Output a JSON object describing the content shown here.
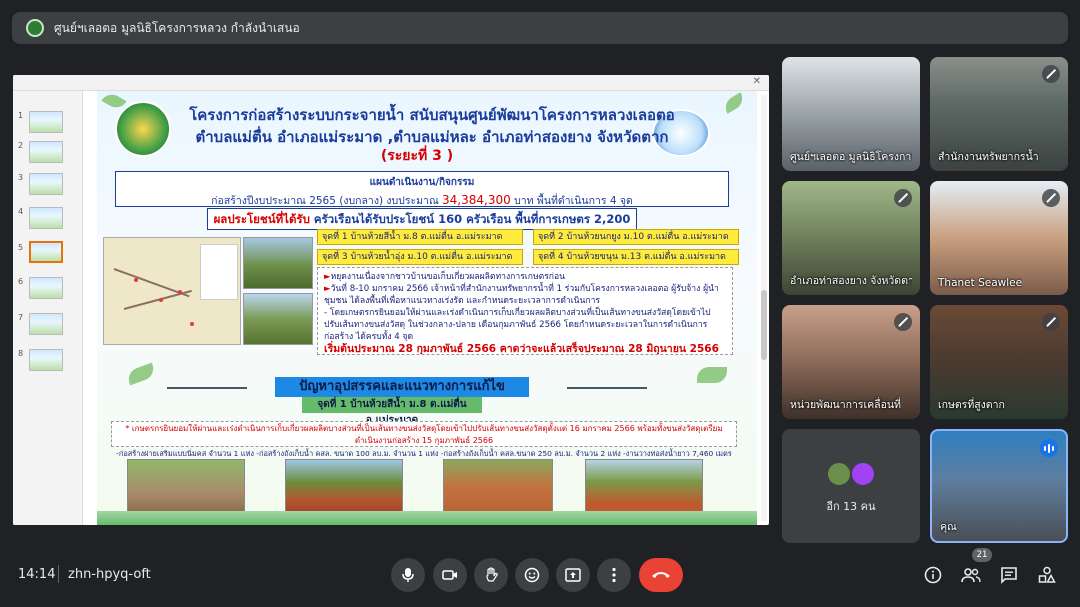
{
  "presenter": {
    "title": "ศูนย์ฯเลอตอ มูลนิธิโครงการหลวง กำลังนำเสนอ"
  },
  "slide": {
    "title_line1": "โครงการก่อสร้างระบบกระจายน้ำ สนับสนุนศูนย์พัฒนาโครงการหลวงเลอตอ",
    "title_line2": "ตำบลแม่ตื่น อำเภอแม่ระมาด ,ตำบลแม่หละ อำเภอท่าสองยาง จังหวัดตาก",
    "phase": "(ระยะที่ 3 )",
    "plan_heading": "แผนดำเนินงาน/กิจกรรม",
    "plan_text_pre": "ก่อสร้างปีงบประมาณ 2565 (งบกลาง) งบประมาณ",
    "plan_amount": "34,384,300",
    "plan_text_post": "บาท พื้นที่ดำเนินการ 4 จุด",
    "benefit_label": "ผลประโยชน์ที่ได้รับ",
    "benefit_text": "ครัวเรือนได้รับประโยชน์ 160 ครัวเรือน  พื้นที่การเกษตร 2,200",
    "sites": [
      "จุดที่ 1 บ้านห้วยสีน้ำ ม.8 ต.แม่ตื่น อ.แม่ระมาด",
      "จุดที่ 2 บ้านห้วยนกยูง ม.10 ต.แม่ตื่น อ.แม่ระมาด",
      "จุดที่ 3 บ้านห้วยน้ำอุ่ง ม.10 ต.แม่ตื่น อ.แม่ระมาด",
      "จุดที่ 4 บ้านห้วยขนุน ม.13 ต.แม่ตื่น อ.แม่ระมาด"
    ],
    "notes": {
      "n1": "หยุดงานเนื่องจากชาวบ้านขอเก็บเกี่ยวผลผลิตทางการเกษตรก่อน",
      "n2": "วันที่ 8-10 มกราคม 2566 เจ้าหน้าที่สำนักงานทรัพยากรน้ำที่ 1 ร่วมกับโครงการหลวงเลอตอ ผู้รับจ้าง ผู้นำชุมชน ได้ลงพื้นที่เพื่อหาแนวทางเร่งรัด และกำหนดระยะเวลาการดำเนินการ",
      "n3": "- โดยเกษตรกรยินยอมให้ผ่านและเร่งดำเนินการเก็บเกี่ยวผลผลิตบางส่วนที่เป็นเส้นทางขนส่งวัสดุโดยเข้าไปปรับเส้นทางขนส่งวัสดุ ในช่วงกลาง-ปลาย เดือนกุมภาพันธ์ 2566   โดยกำหนดระยะเวลาในการดำเนินการก่อสร้าง ได้ครบทั้ง 4  จุด",
      "n4": "เริ่มต้นประมาณ 28  กุมภาพันธ์ 2566  คาดว่าจะแล้วเสร็จประมาณ 28 มิถุนายน 2566"
    },
    "problem_title": "ปัญหาอุปสรรคและแนวทางการแก้ไข",
    "problem_sub": "จุดที่ 1 บ้านห้วยสีน้ำ ม.8 ต.แม่ตื่น อ.แม่ระมาด",
    "warning": "* เกษตรกรยินยอมให้ผ่านและเร่งดำเนินการเก็บเกี่ยวผลผลิตบางส่วนที่เป็นเส้นทางขนส่งวัสดุโดยเข้าไปปรับเส้นทางขนส่งวัสดุตั้งแต่ 16 มกราคม 2566 พร้อมทั้งขนส่งวัสดุเตรียมดำเนินงานก่อสร้าง 15 กุมภาพันธ์ 2566",
    "description": "-ก่อสร้างฝายเสริมแบบนิ่มคส จำนวน 1 แห่ง  -ก่อสร้างถังเก็บน้ำ คสล. ขนาด 100 ลบ.ม. จำนวน 1 แห่ง  -ก่อสร้างถังเก็บน้ำ คสล.ขนาด 250 ลบ.ม. จำนวน 2 แห่ง  -งานวางท่อส่งน้ำยาว 7,460 เมตร"
  },
  "thumbnails": [
    "1",
    "2",
    "3",
    "4",
    "5",
    "6",
    "7",
    "8"
  ],
  "participants": [
    {
      "name": "ศูนย์ฯเลอตอ มูลนิธิโครงการหลวง",
      "muted": false
    },
    {
      "name": "สำนักงานทรัพยากรน้ำ",
      "muted": true
    },
    {
      "name": "อำเภอท่าสองยาง จังหวัดตาก",
      "muted": true
    },
    {
      "name": "Thanet Seawlee",
      "muted": true
    },
    {
      "name": "หน่วยพัฒนาการเคลื่อนที่",
      "muted": true
    },
    {
      "name": "เกษตรที่สูงตาก",
      "muted": true
    },
    {
      "name": "คุณ",
      "muted": false
    }
  ],
  "more_participants": "อีก 13 คน",
  "meeting": {
    "time": "14:14",
    "code": "zhn-hpyq-oft",
    "participant_count": "21"
  },
  "icons": {
    "mic": "microphone-icon",
    "camera": "camera-icon",
    "hand": "raise-hand-icon",
    "emoji": "emoji-icon",
    "present": "present-icon",
    "more": "more-options-icon",
    "hangup": "hang-up-icon",
    "info": "info-icon",
    "people": "people-icon",
    "chat": "chat-icon",
    "activities": "activities-icon"
  },
  "colors": {
    "background": "#202124",
    "tile": "#3c4043",
    "hangup": "#ea4335",
    "speaking": "#1a73e8"
  }
}
